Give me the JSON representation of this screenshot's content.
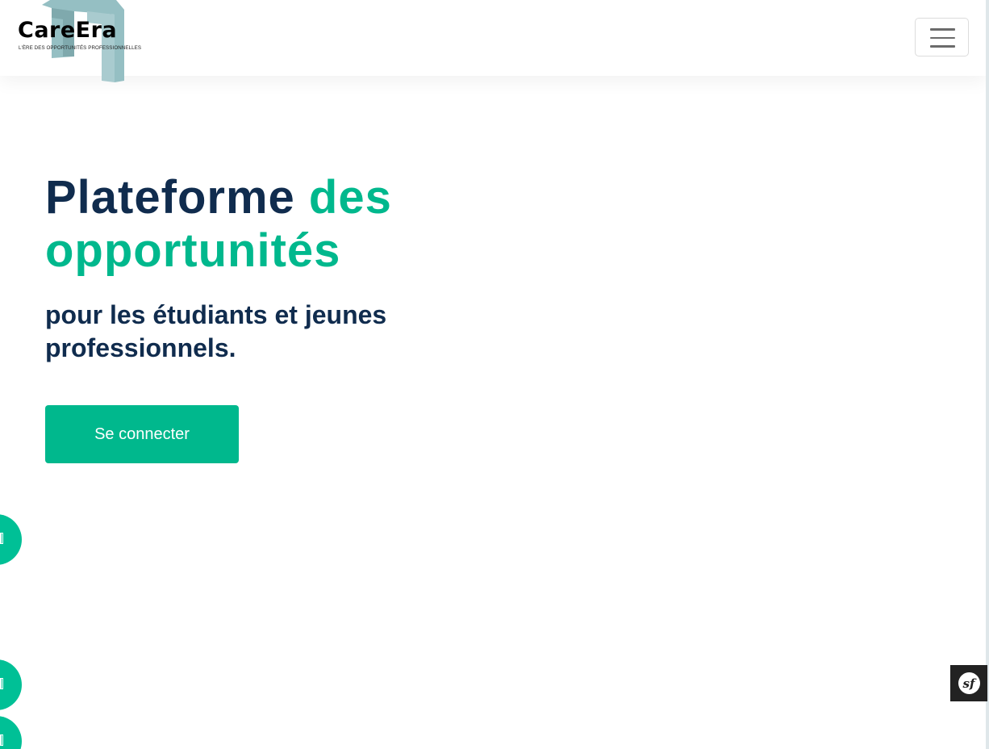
{
  "brand": {
    "name": "CareEra",
    "tagline": "L'ÈRE DES OPPORTUNITÉS PROFESSIONNELLES",
    "logo_colors": [
      "#7fb3b7",
      "#a7c7cb"
    ]
  },
  "navbar": {
    "menu_icon": "hamburger-menu-icon"
  },
  "hero": {
    "title_part1": "Plateforme",
    "title_part2": "des opportunités",
    "subtitle": "pour les étudiants et jeunes professionnels.",
    "cta_label": "Se connecter"
  },
  "floating_buttons": [
    {
      "icon": "missing-glyph-icon"
    },
    {
      "icon": "missing-glyph-icon"
    },
    {
      "icon": "missing-glyph-icon"
    }
  ],
  "debug_toolbar": {
    "label": "sf",
    "icon": "symfony-icon"
  },
  "colors": {
    "primary": "#00b88d",
    "heading": "#102c4e",
    "toolbar": "#222222"
  }
}
